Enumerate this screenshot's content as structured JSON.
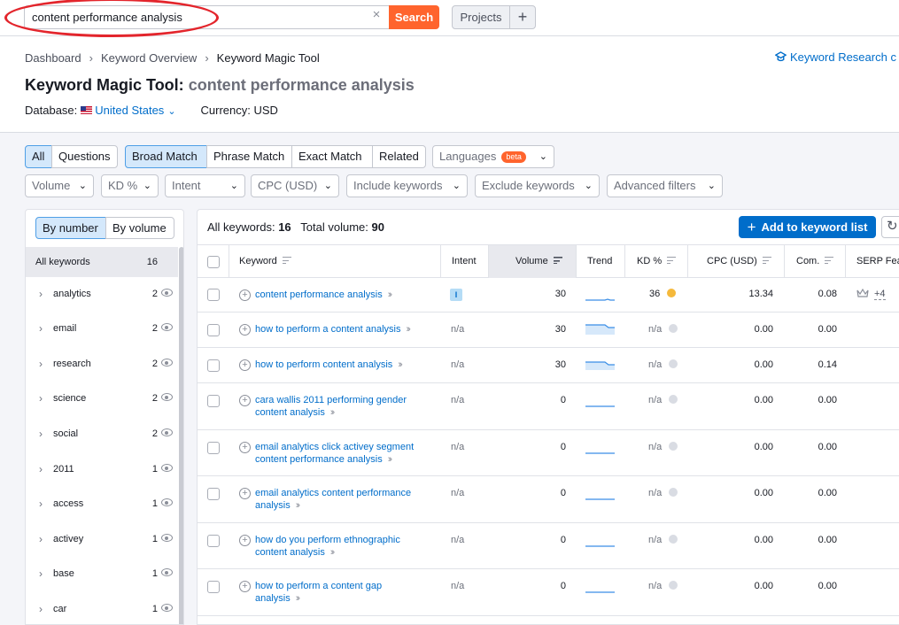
{
  "topbar": {
    "search_value": "content performance analysis",
    "clear_glyph": "×",
    "search_button": "Search",
    "projects_button": "Projects",
    "plus_button": "+"
  },
  "breadcrumb": [
    "Dashboard",
    "Keyword Overview",
    "Keyword Magic Tool"
  ],
  "kr_link": "Keyword Research c",
  "title": {
    "tool": "Keyword Magic Tool:",
    "query": "content performance analysis"
  },
  "database": {
    "label": "Database:",
    "country": "United States",
    "currency": "Currency: USD"
  },
  "match_tabs": {
    "all": "All",
    "questions": "Questions",
    "broad": "Broad Match",
    "phrase": "Phrase Match",
    "exact": "Exact Match",
    "related": "Related",
    "languages": "Languages",
    "beta": "beta"
  },
  "filters": [
    "Volume",
    "KD %",
    "Intent",
    "CPC (USD)",
    "Include keywords",
    "Exclude keywords",
    "Advanced filters"
  ],
  "left_panel": {
    "by_number": "By number",
    "by_volume": "By volume",
    "all_keywords_label": "All keywords",
    "all_keywords_count": "16",
    "groups": [
      {
        "name": "analytics",
        "count": "2"
      },
      {
        "name": "email",
        "count": "2"
      },
      {
        "name": "research",
        "count": "2"
      },
      {
        "name": "science",
        "count": "2"
      },
      {
        "name": "social",
        "count": "2"
      },
      {
        "name": "2011",
        "count": "1"
      },
      {
        "name": "access",
        "count": "1"
      },
      {
        "name": "activey",
        "count": "1"
      },
      {
        "name": "base",
        "count": "1"
      },
      {
        "name": "car",
        "count": "1"
      }
    ]
  },
  "summary": {
    "all_label": "All keywords:",
    "all_value": "16",
    "volume_label": "Total volume:",
    "volume_value": "90"
  },
  "add_button": "Add to keyword list",
  "columns": {
    "keyword": "Keyword",
    "intent": "Intent",
    "volume": "Volume",
    "trend": "Trend",
    "kd": "KD %",
    "cpc": "CPC (USD)",
    "com": "Com.",
    "serp": "SERP Fea"
  },
  "rows": [
    {
      "keyword": "content performance analysis",
      "intent": "I",
      "volume": "30",
      "kd": "36",
      "cpc": "13.34",
      "com": "0.08",
      "serp_extra": "+4"
    },
    {
      "keyword": "how to perform a content analysis",
      "intent": "n/a",
      "volume": "30",
      "kd": "n/a",
      "cpc": "0.00",
      "com": "0.00",
      "serp_extra": ""
    },
    {
      "keyword": "how to perform content analysis",
      "intent": "n/a",
      "volume": "30",
      "kd": "n/a",
      "cpc": "0.00",
      "com": "0.14",
      "serp_extra": ""
    },
    {
      "keyword": "cara wallis 2011 performing gender content analysis",
      "intent": "n/a",
      "volume": "0",
      "kd": "n/a",
      "cpc": "0.00",
      "com": "0.00",
      "serp_extra": ""
    },
    {
      "keyword": "email analytics click activey segment content performance analysis",
      "intent": "n/a",
      "volume": "0",
      "kd": "n/a",
      "cpc": "0.00",
      "com": "0.00",
      "serp_extra": ""
    },
    {
      "keyword": "email analytics content performance analysis",
      "intent": "n/a",
      "volume": "0",
      "kd": "n/a",
      "cpc": "0.00",
      "com": "0.00",
      "serp_extra": ""
    },
    {
      "keyword": "how do you perform ethnographic content analysis",
      "intent": "n/a",
      "volume": "0",
      "kd": "n/a",
      "cpc": "0.00",
      "com": "0.00",
      "serp_extra": ""
    },
    {
      "keyword": "how to perform a content gap analysis",
      "intent": "n/a",
      "volume": "0",
      "kd": "n/a",
      "cpc": "0.00",
      "com": "0.00",
      "serp_extra": ""
    }
  ],
  "icons": {
    "search_clear": "close-icon",
    "kr_link": "graduation-cap-icon",
    "flag": "us-flag-icon",
    "row_add": "plus-circle-icon",
    "row_open": "double-chevron-right-icon",
    "refresh": "refresh-icon",
    "serp": "crown-icon",
    "group_visibility": "eye-icon"
  },
  "colors": {
    "accent": "#006dca",
    "search_button": "#ff642d",
    "highlight_ring": "#e3252c",
    "kd_medium": "#f5b93b"
  }
}
